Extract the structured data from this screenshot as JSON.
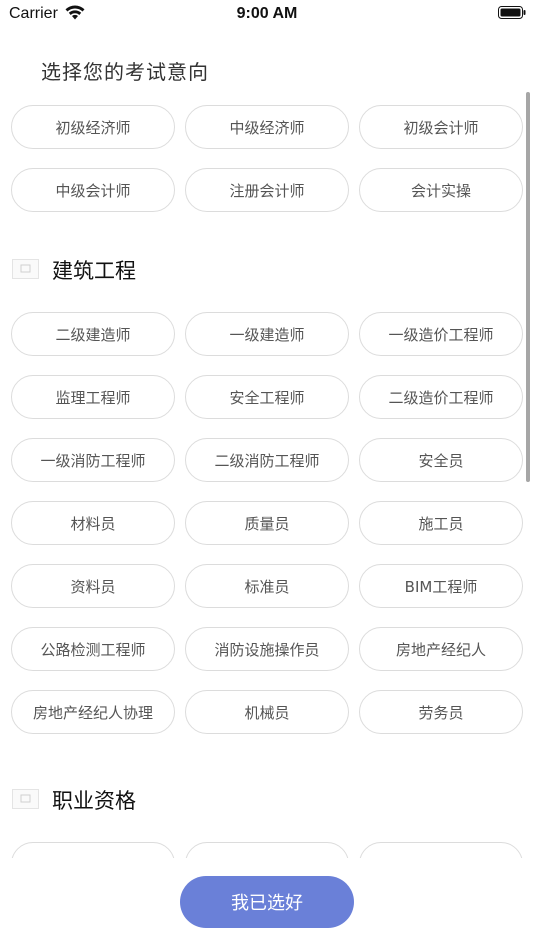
{
  "status_bar": {
    "carrier": "Carrier",
    "time": "9:00 AM"
  },
  "page_title": "选择您的考试意向",
  "sections": [
    {
      "title": "",
      "items": [
        "初级经济师",
        "中级经济师",
        "初级会计师",
        "中级会计师",
        "注册会计师",
        "会计实操"
      ]
    },
    {
      "title": "建筑工程",
      "items": [
        "二级建造师",
        "一级建造师",
        "一级造价工程师",
        "监理工程师",
        "安全工程师",
        "二级造价工程师",
        "一级消防工程师",
        "二级消防工程师",
        "安全员",
        "材料员",
        "质量员",
        "施工员",
        "资料员",
        "标准员",
        "BIM工程师",
        "公路检测工程师",
        "消防设施操作员",
        "房地产经纪人",
        "房地产经纪人协理",
        "机械员",
        "劳务员"
      ]
    },
    {
      "title": "职业资格"
    }
  ],
  "confirm_button": "我已选好",
  "colors": {
    "accent": "#6a80d8",
    "chip_border": "#dcdcdc",
    "chip_text": "#555555"
  }
}
